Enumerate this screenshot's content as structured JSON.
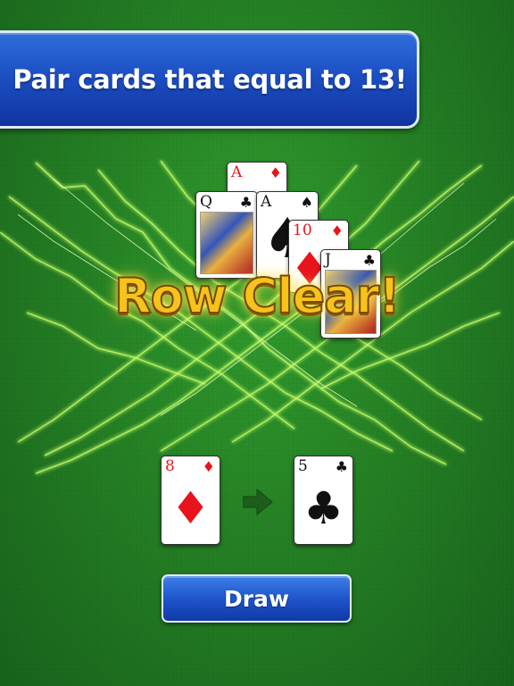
{
  "banner": {
    "text": "Pair cards that equal to 13!"
  },
  "overlay": {
    "text": "Row Clear!"
  },
  "pyramid_cards": [
    {
      "rank": "A",
      "suit": "diamond",
      "suit_glyph": "♦",
      "color": "red"
    },
    {
      "rank": "Q",
      "suit": "club",
      "suit_glyph": "♣",
      "color": "black"
    },
    {
      "rank": "A",
      "suit": "spade",
      "suit_glyph": "♠",
      "color": "black"
    },
    {
      "rank": "10",
      "suit": "diamond",
      "suit_glyph": "♦",
      "color": "red"
    },
    {
      "rank": "J",
      "suit": "club",
      "suit_glyph": "♣",
      "color": "black"
    }
  ],
  "waste_card": {
    "rank": "8",
    "suit": "diamond",
    "suit_glyph": "♦",
    "color": "red"
  },
  "stock_card": {
    "rank": "5",
    "suit": "club",
    "suit_glyph": "♣",
    "color": "black"
  },
  "arrow_icon": "arrow-right-icon",
  "draw_button": {
    "label": "Draw"
  },
  "colors": {
    "felt": "#237f22",
    "banner_blue": "#1c4fc3",
    "row_clear_gold": "#f6c21c",
    "lightning": "#c8ff6a",
    "card_red": "#e8141c"
  }
}
